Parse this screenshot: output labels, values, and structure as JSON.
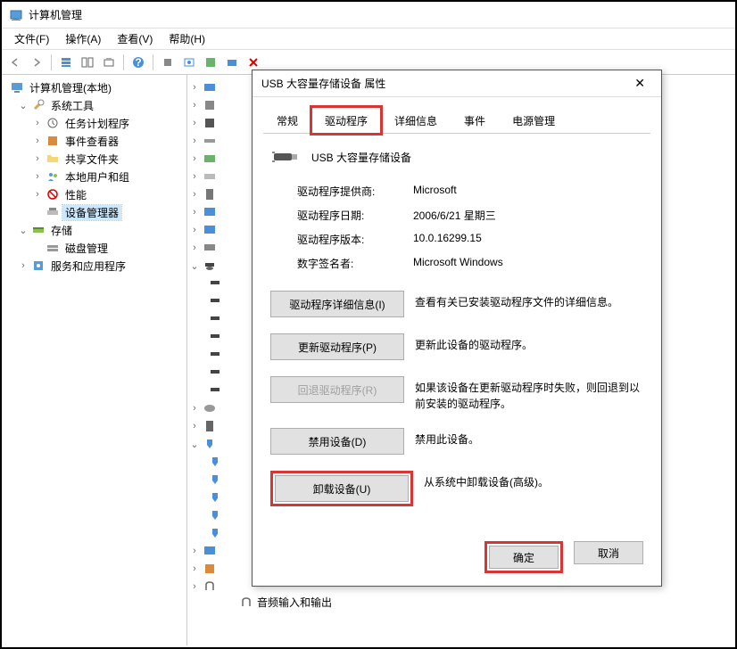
{
  "window": {
    "title": "计算机管理"
  },
  "menu": {
    "file": "文件(F)",
    "action": "操作(A)",
    "view": "查看(V)",
    "help": "帮助(H)"
  },
  "tree": {
    "root": "计算机管理(本地)",
    "system_tools": "系统工具",
    "task_scheduler": "任务计划程序",
    "event_viewer": "事件查看器",
    "shared_folders": "共享文件夹",
    "local_users": "本地用户和组",
    "performance": "性能",
    "device_manager": "设备管理器",
    "storage": "存储",
    "disk_mgmt": "磁盘管理",
    "services_apps": "服务和应用程序"
  },
  "bottom_label": "音频输入和输出",
  "dialog": {
    "title": "USB 大容量存储设备 属性",
    "tabs": {
      "general": "常规",
      "driver": "驱动程序",
      "details": "详细信息",
      "events": "事件",
      "power": "电源管理"
    },
    "device_name": "USB 大容量存储设备",
    "info": {
      "provider_k": "驱动程序提供商:",
      "provider_v": "Microsoft",
      "date_k": "驱动程序日期:",
      "date_v": "2006/6/21 星期三",
      "version_k": "驱动程序版本:",
      "version_v": "10.0.16299.15",
      "signer_k": "数字签名者:",
      "signer_v": "Microsoft Windows"
    },
    "buttons": {
      "details": "驱动程序详细信息(I)",
      "details_desc": "查看有关已安装驱动程序文件的详细信息。",
      "update": "更新驱动程序(P)",
      "update_desc": "更新此设备的驱动程序。",
      "rollback": "回退驱动程序(R)",
      "rollback_desc": "如果该设备在更新驱动程序时失败，则回退到以前安装的驱动程序。",
      "disable": "禁用设备(D)",
      "disable_desc": "禁用此设备。",
      "uninstall": "卸载设备(U)",
      "uninstall_desc": "从系统中卸载设备(高级)。"
    },
    "ok": "确定",
    "cancel": "取消"
  }
}
